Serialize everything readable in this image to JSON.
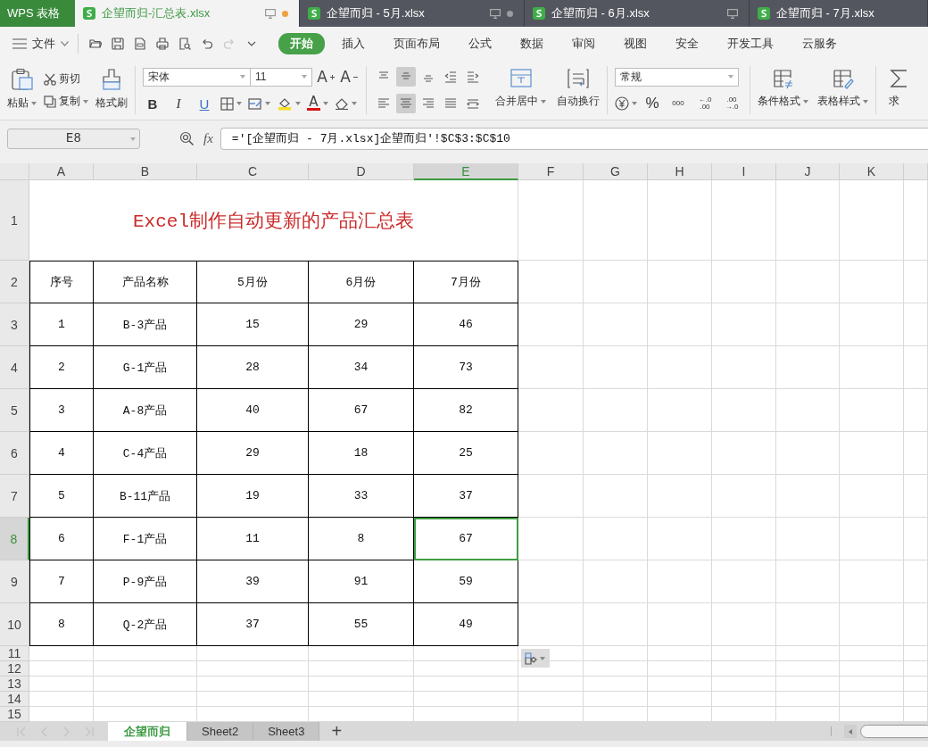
{
  "tab_bar": {
    "app_label": "WPS 表格",
    "documents": [
      {
        "title": "企望而归-汇总表.xlsx",
        "selected": true,
        "monitor": true,
        "modified": true
      },
      {
        "title": "企望而归 - 5月.xlsx",
        "selected": false,
        "monitor": true,
        "modified": true
      },
      {
        "title": "企望而归 - 6月.xlsx",
        "selected": false,
        "monitor": true,
        "modified": false
      },
      {
        "title": "企望而归 - 7月.xlsx",
        "selected": false,
        "monitor": false,
        "modified": false
      }
    ]
  },
  "menu_bar": {
    "file_label": "文件",
    "quick_access": [
      {
        "kind": "open",
        "disabled": false
      },
      {
        "kind": "save",
        "disabled": false
      },
      {
        "kind": "pdf",
        "disabled": false
      },
      {
        "kind": "print",
        "disabled": false
      },
      {
        "kind": "preview",
        "disabled": false
      },
      {
        "kind": "undo",
        "disabled": false
      },
      {
        "kind": "redo",
        "disabled": true
      },
      {
        "kind": "more",
        "disabled": false
      }
    ],
    "tabs": [
      {
        "label": "开始",
        "selected": true
      },
      {
        "label": "插入",
        "selected": false
      },
      {
        "label": "页面布局",
        "selected": false
      },
      {
        "label": "公式",
        "selected": false
      },
      {
        "label": "数据",
        "selected": false
      },
      {
        "label": "审阅",
        "selected": false
      },
      {
        "label": "视图",
        "selected": false
      },
      {
        "label": "安全",
        "selected": false
      },
      {
        "label": "开发工具",
        "selected": false
      },
      {
        "label": "云服务",
        "selected": false
      }
    ]
  },
  "ribbon": {
    "paste": "粘贴",
    "cut": "剪切",
    "copy": "复制",
    "format_painter": "格式刷",
    "font": {
      "name": "宋体",
      "size": "11",
      "grow": "A",
      "shrink": "A",
      "bold": "B",
      "italic": "I",
      "underline": "U",
      "color_letter": "A"
    },
    "align_rows": [
      [
        {
          "kind": "top",
          "selected": false
        },
        {
          "kind": "middle",
          "selected": true
        },
        {
          "kind": "bottom",
          "selected": false
        },
        {
          "kind": "outdent",
          "selected": false
        },
        {
          "kind": "indent",
          "selected": false
        }
      ],
      [
        {
          "kind": "left",
          "selected": false
        },
        {
          "kind": "center",
          "selected": true
        },
        {
          "kind": "right",
          "selected": false
        },
        {
          "kind": "justify",
          "selected": false
        },
        {
          "kind": "distribute",
          "selected": false
        }
      ]
    ],
    "merge_center": "合并居中",
    "wrap_text": "自动换行",
    "number_format": "常规",
    "percent": "%",
    "thousands": "000",
    "decimal_buttons": [
      {
        "top": "←.0",
        "bottom": ".00"
      },
      {
        "top": ".00",
        "bottom": "→.0"
      }
    ],
    "conditional_format": "条件格式",
    "table_style": "表格样式",
    "sum": "求"
  },
  "formula_bar": {
    "name_box": "E8",
    "fx": "fx",
    "formula": "='[企望而归 - 7月.xlsx]企望而归'!$C$3:$C$10"
  },
  "sheet": {
    "columns": [
      {
        "label": "A",
        "selected": false
      },
      {
        "label": "B",
        "selected": false
      },
      {
        "label": "C",
        "selected": false
      },
      {
        "label": "D",
        "selected": false
      },
      {
        "label": "E",
        "selected": true
      },
      {
        "label": "F",
        "selected": false
      },
      {
        "label": "G",
        "selected": false
      },
      {
        "label": "H",
        "selected": false
      },
      {
        "label": "I",
        "selected": false
      },
      {
        "label": "J",
        "selected": false
      },
      {
        "label": "K",
        "selected": false
      }
    ],
    "rows": [
      {
        "label": "1",
        "selected": false
      },
      {
        "label": "2",
        "selected": false
      },
      {
        "label": "3",
        "selected": false
      },
      {
        "label": "4",
        "selected": false
      },
      {
        "label": "5",
        "selected": false
      },
      {
        "label": "6",
        "selected": false
      },
      {
        "label": "7",
        "selected": false
      },
      {
        "label": "8",
        "selected": true
      },
      {
        "label": "9",
        "selected": false
      },
      {
        "label": "10",
        "selected": false
      },
      {
        "label": "11",
        "selected": false
      },
      {
        "label": "12",
        "selected": false
      },
      {
        "label": "13",
        "selected": false
      },
      {
        "label": "14",
        "selected": false
      },
      {
        "label": "15",
        "selected": false
      }
    ],
    "title": "Excel制作自动更新的产品汇总表",
    "table": {
      "header": [
        "序号",
        "产品名称",
        "5月份",
        "6月份",
        "7月份"
      ],
      "rows": [
        [
          "1",
          "B-3产品",
          "15",
          "29",
          "46"
        ],
        [
          "2",
          "G-1产品",
          "28",
          "34",
          "73"
        ],
        [
          "3",
          "A-8产品",
          "40",
          "67",
          "82"
        ],
        [
          "4",
          "C-4产品",
          "29",
          "18",
          "25"
        ],
        [
          "5",
          "B-11产品",
          "19",
          "33",
          "37"
        ],
        [
          "6",
          "F-1产品",
          "11",
          "8",
          "67"
        ],
        [
          "7",
          "P-9产品",
          "39",
          "91",
          "59"
        ],
        [
          "8",
          "Q-2产品",
          "37",
          "55",
          "49"
        ]
      ]
    }
  },
  "sheet_bar": {
    "nav_disabled": true,
    "tabs": [
      {
        "label": "企望而归",
        "selected": true
      },
      {
        "label": "Sheet2",
        "selected": false
      },
      {
        "label": "Sheet3",
        "selected": false
      }
    ],
    "add_label": "+"
  }
}
